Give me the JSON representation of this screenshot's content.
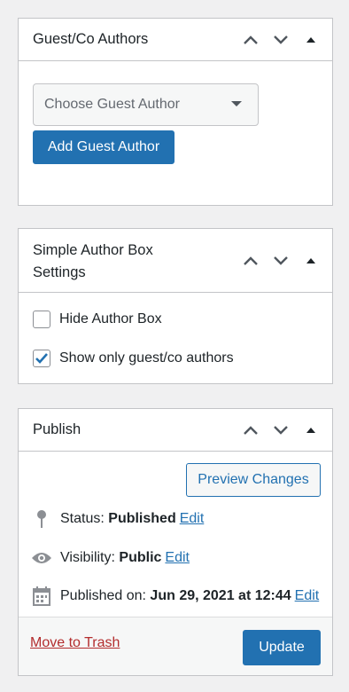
{
  "guest_box": {
    "title": "Guest/Co Authors",
    "select_value": "Choose Guest Author",
    "add_button": "Add Guest Author"
  },
  "settings_box": {
    "title_line1": "Simple Author Box",
    "title_line2": "Settings",
    "options": [
      {
        "label": "Hide Author Box",
        "checked": false
      },
      {
        "label": "Show only guest/co authors",
        "checked": true
      }
    ]
  },
  "publish_box": {
    "title": "Publish",
    "preview_button": "Preview Changes",
    "status_label": "Status:",
    "status_value": "Published",
    "visibility_label": "Visibility:",
    "visibility_value": "Public",
    "published_label": "Published on:",
    "published_value": "Jun 29, 2021 at 12:44",
    "edit_link": "Edit",
    "trash_link": "Move to Trash",
    "update_button": "Update"
  },
  "colors": {
    "primary": "#2271b1",
    "danger": "#b32d2e",
    "border": "#c3c4c7",
    "background": "#f0f0f1"
  }
}
